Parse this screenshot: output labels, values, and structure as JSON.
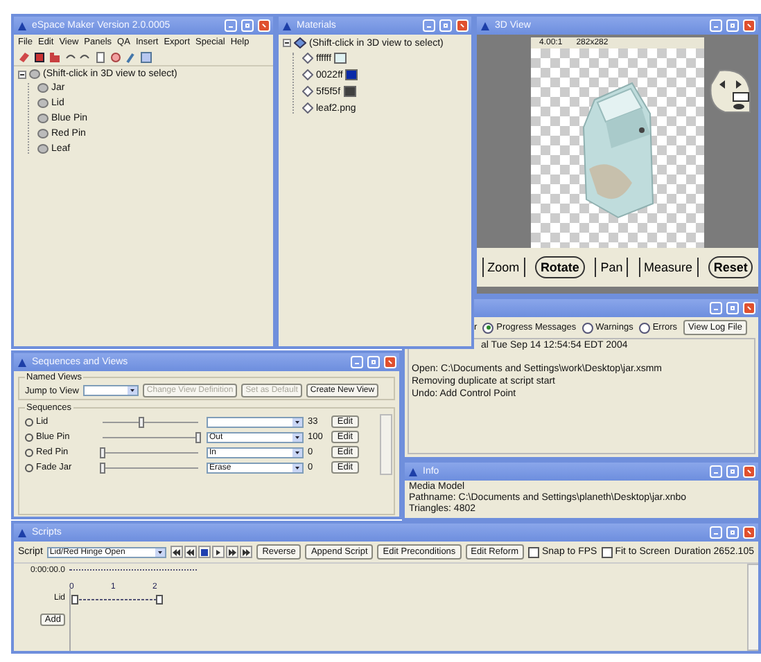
{
  "main_window": {
    "title": "eSpace Maker   Version 2.0.0005",
    "menu": [
      "File",
      "Edit",
      "View",
      "Panels",
      "QA",
      "Insert",
      "Export",
      "Special",
      "Help"
    ],
    "tree": {
      "label": "(Shift-click in 3D view to select)",
      "expanded": true,
      "children": [
        {
          "label": "Jar"
        },
        {
          "label": "Lid"
        },
        {
          "label": "Blue Pin"
        },
        {
          "label": "Red Pin"
        },
        {
          "label": "Leaf"
        }
      ]
    }
  },
  "materials_window": {
    "title": "Materials",
    "tree": {
      "label": "(Shift-click in 3D view to select)",
      "expanded": true,
      "children": [
        {
          "label": "ffffff",
          "color": "#dff2f2"
        },
        {
          "label": "0022ff",
          "color": "#0a2aa8"
        },
        {
          "label": "5f5f5f",
          "color": "#404040"
        },
        {
          "label": "leaf2.png"
        }
      ]
    }
  },
  "view_window": {
    "title": "3D View",
    "zoom_readout": "4.00:1",
    "size_readout": "282x282",
    "tools": [
      "Zoom",
      "Rotate",
      "Pan",
      "Measure",
      "Reset"
    ]
  },
  "messages_window": {
    "filter_label": "r",
    "filters": [
      {
        "label": "Progress Messages",
        "selected": true
      },
      {
        "label": "Warnings",
        "selected": false
      },
      {
        "label": "Errors",
        "selected": false
      }
    ],
    "log_button": "View Log File",
    "lines": [
      "al Tue Sep 14 12:54:54 EDT 2004",
      "Open: C:\\Documents and Settings\\work\\Desktop\\jar.xsmm",
      "Removing duplicate at script start",
      "Undo: Add Control Point"
    ]
  },
  "info_window": {
    "title": "Info",
    "lines": [
      "Media Model",
      "Pathname: C:\\Documents and Settings\\planeth\\Desktop\\jar.xnbo",
      "Triangles: 4802"
    ]
  },
  "sequences_window": {
    "title": "Sequences and Views",
    "views_legend": "Named Views",
    "jump_label": "Jump to View",
    "view_buttons": [
      {
        "label": "Change View Definition",
        "disabled": true
      },
      {
        "label": "Set as Default",
        "disabled": true
      },
      {
        "label": "Create New View",
        "disabled": false
      }
    ],
    "sequences_legend": "Sequences",
    "rows": [
      {
        "name": "Lid",
        "level": 0.4,
        "value": "33",
        "edit": "Edit"
      },
      {
        "name": "Blue Pin",
        "level": 1,
        "state": "Out",
        "value": "100",
        "edit": "Edit"
      },
      {
        "name": "Red Pin",
        "level": 0,
        "state": "In",
        "value": "0",
        "edit": "Edit"
      },
      {
        "name": "Fade Jar",
        "level": 0,
        "state": "Erase",
        "value": "0",
        "edit": "Edit"
      }
    ]
  },
  "scripts_window": {
    "title": "Scripts",
    "script_label": "Script",
    "script": "Lid/Red Hinge Open",
    "buttons": [
      "Reverse",
      "Append Script",
      "Edit Preconditions",
      "Edit Reform"
    ],
    "options": [
      {
        "label": "Snap to FPS",
        "checked": false
      },
      {
        "label": "Fit to Screen",
        "checked": false
      }
    ],
    "duration": "Duration 2652.105",
    "time": "0:00:00.0",
    "ticks": [
      "0",
      "1",
      "2"
    ],
    "tracks": [
      "Lid"
    ],
    "add_button": "Add"
  }
}
